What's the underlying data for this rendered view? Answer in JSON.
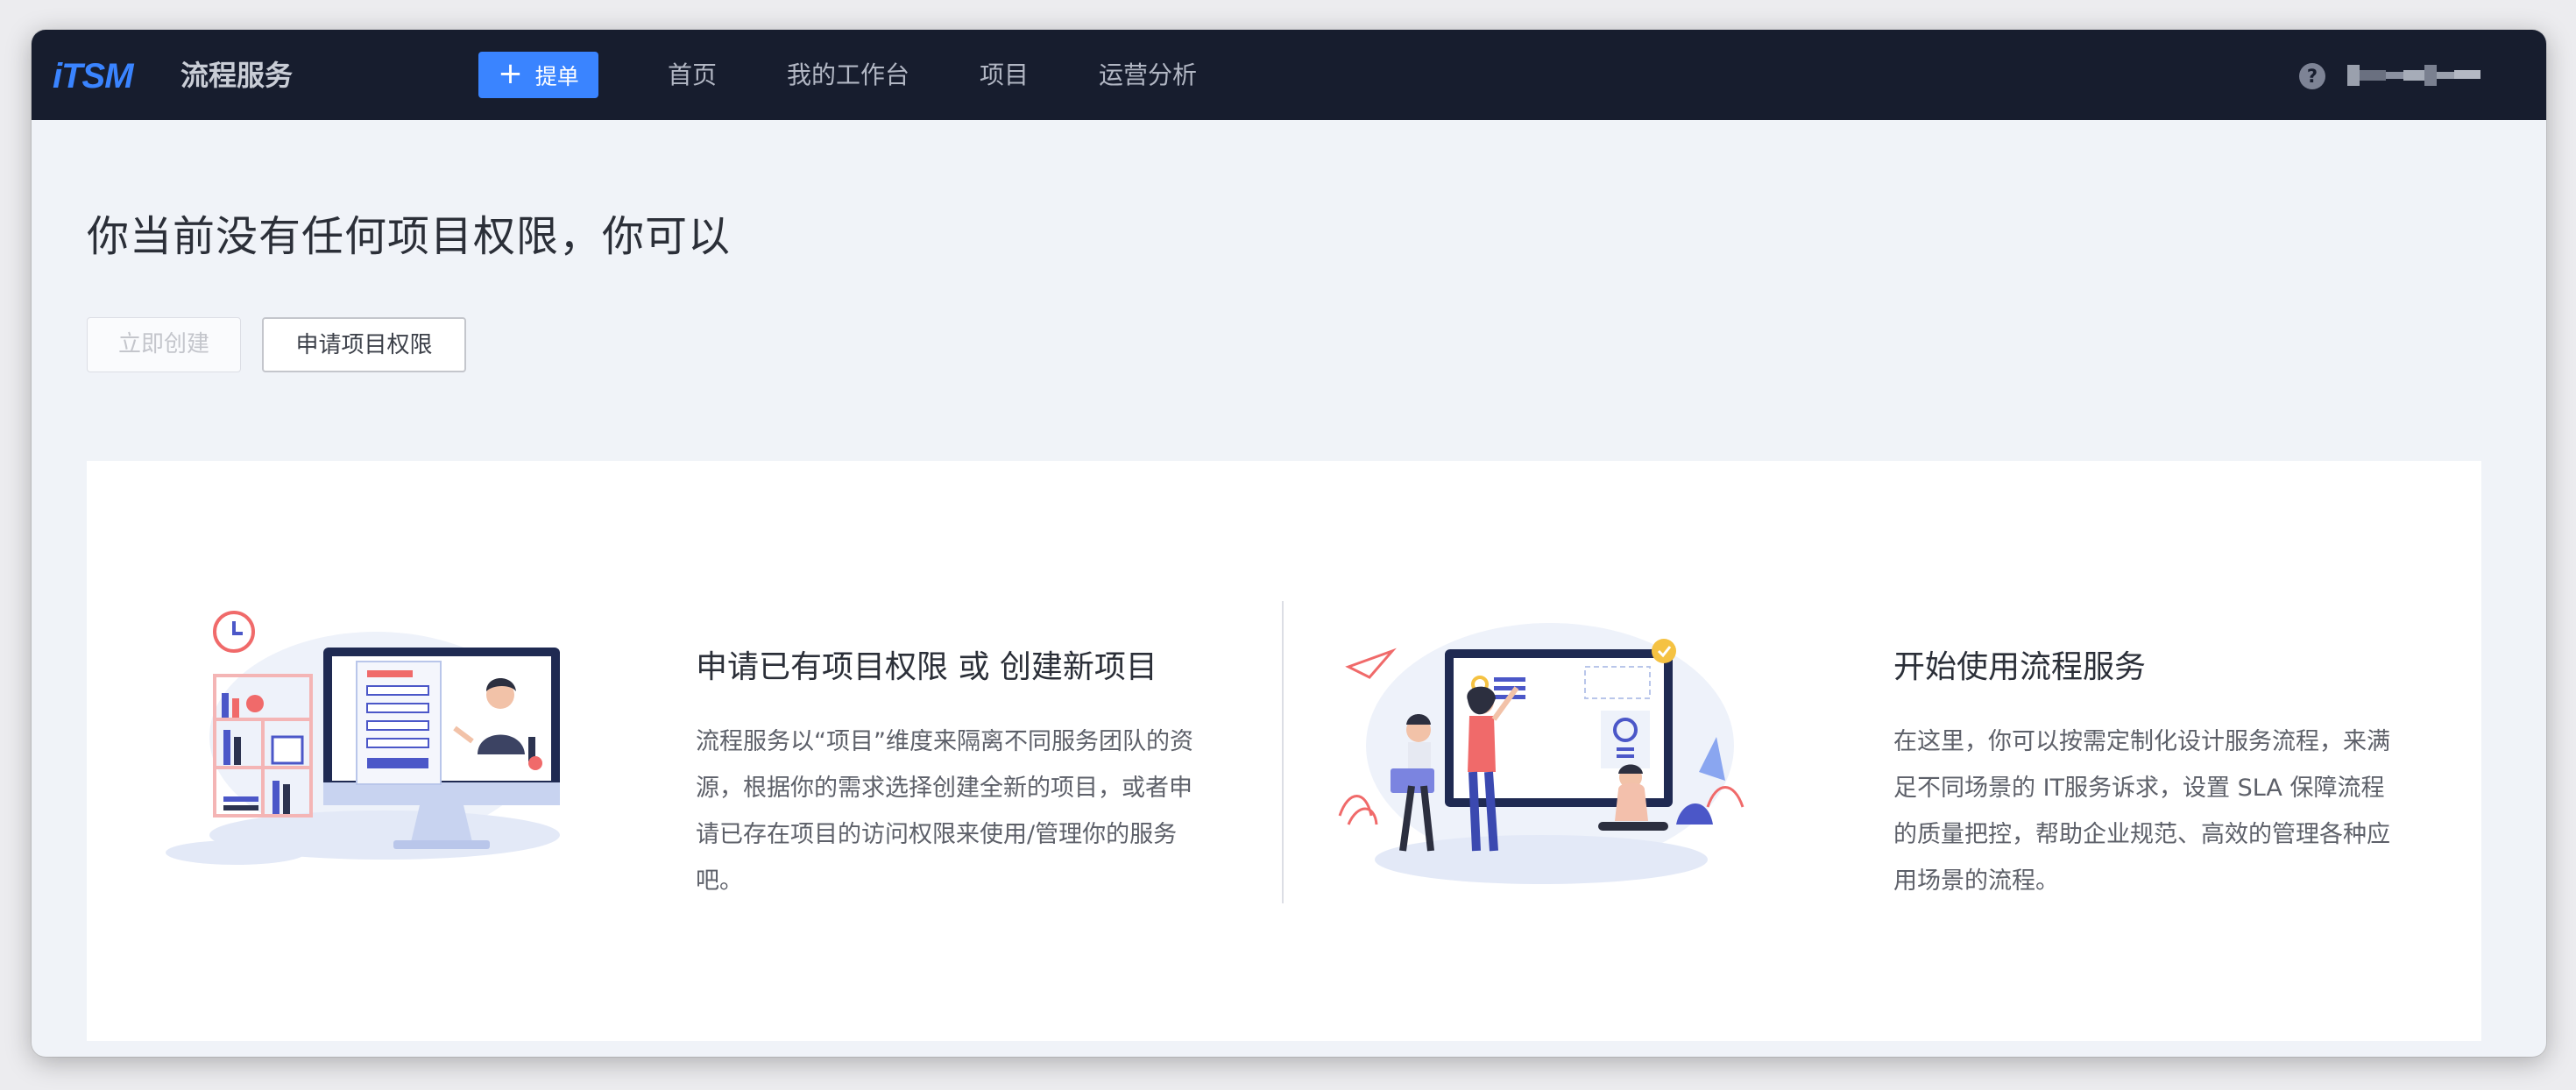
{
  "header": {
    "logo_text": "iTSM",
    "product_name": "流程服务",
    "create_button_label": "提单",
    "nav": [
      "首页",
      "我的工作台",
      "项目",
      "运营分析"
    ],
    "help_glyph": "?"
  },
  "page": {
    "title": "你当前没有任何项目权限，你可以",
    "create_now_label": "立即创建",
    "apply_permission_label": "申请项目权限"
  },
  "guides": [
    {
      "title": "申请已有项目权限 或 创建新项目",
      "lines": [
        "流程服务以“项目”维度来隔离不同服务团队的资",
        "源，根据你的需求选择创建全新的项目，或者申",
        "请已存在项目的访问权限来使用/管理你的服务",
        "吧。"
      ]
    },
    {
      "title": "开始使用流程服务",
      "lines": [
        "在这里，你可以按需定制化设计服务流程，来满",
        "足不同场景的 IT服务诉求，设置 SLA 保障流程",
        "的质量把控，帮助企业规范、高效的管理各种应",
        "用场景的流程。"
      ]
    }
  ],
  "colors": {
    "navbar": "#171d2e",
    "primary": "#3a84ff",
    "page_bg": "#f0f3f8"
  }
}
